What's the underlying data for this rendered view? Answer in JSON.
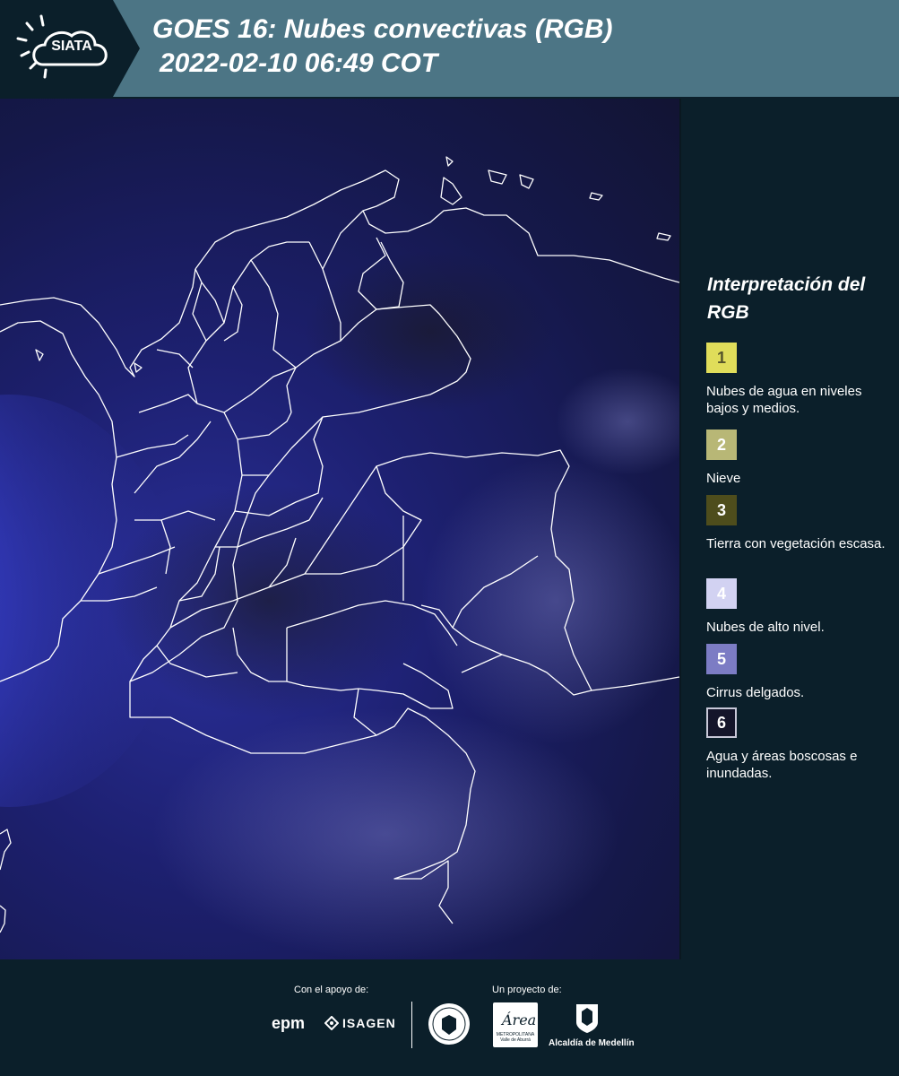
{
  "header": {
    "logo_text": "SIATA",
    "title_line1": "GOES 16: Nubes convectivas (RGB)",
    "title_line2": "2022-02-10 06:49 COT"
  },
  "map": {
    "background_color": "#1a1d5c",
    "border_color": "#ffffff"
  },
  "legend": {
    "title": "Interpretación del RGB",
    "items": [
      {
        "number": "1",
        "label": "Nubes de agua en niveles bajos y medios.",
        "color": "#e0dd5a",
        "text_color": "#55542a"
      },
      {
        "number": "2",
        "label": "Nieve",
        "color": "#b8b776",
        "text_color": "#ffffff"
      },
      {
        "number": "3",
        "label": "Tierra con vegetación escasa.",
        "color": "#4e4d1c",
        "text_color": "#ffffff"
      },
      {
        "number": "4",
        "label": "Nubes de alto nivel.",
        "color": "#d2d2f2",
        "text_color": "#ffffff"
      },
      {
        "number": "5",
        "label": "Cirrus delgados.",
        "color": "#7c7cc4",
        "text_color": "#ffffff"
      },
      {
        "number": "6",
        "label": "Agua y áreas boscosas e inundadas.",
        "color": "#14152a",
        "text_color": "#ffffff"
      }
    ]
  },
  "footer": {
    "support_label": "Con el apoyo de:",
    "project_label": "Un proyecto de:",
    "epm": "epm",
    "isagen": "ISAGEN",
    "area_word": "Área",
    "area_sub": "METROPOLITANA Valle de Aburrá",
    "alcaldia": "Alcaldía de Medellín"
  }
}
